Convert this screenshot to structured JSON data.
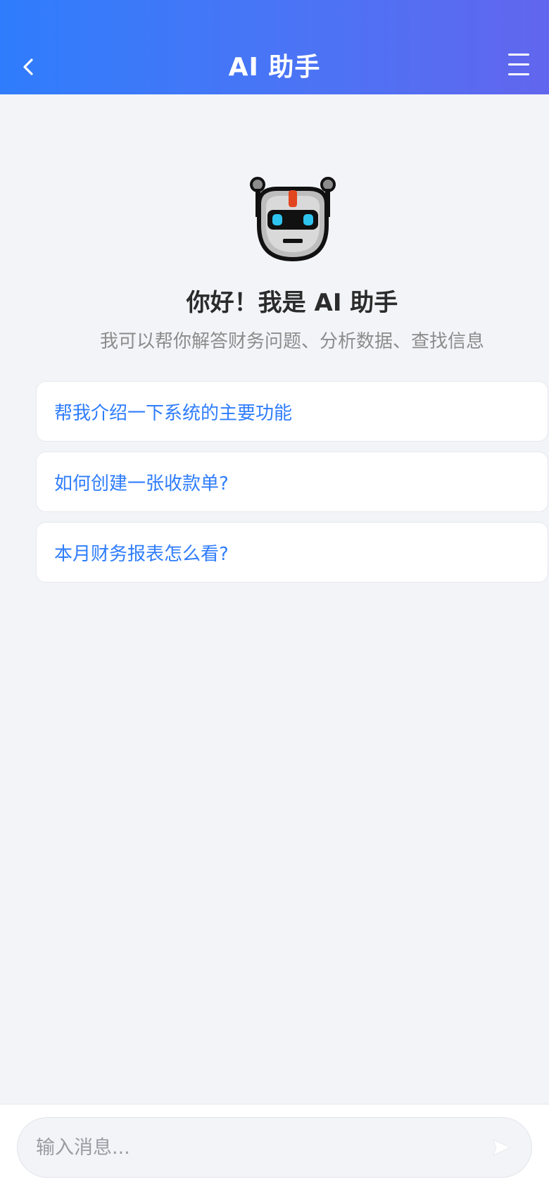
{
  "header": {
    "title": "AI 助手"
  },
  "welcome": {
    "greeting": "你好！我是 AI 助手",
    "subtitle": "我可以帮你解答财务问题、分析数据、查找信息"
  },
  "suggestions": [
    "帮我介绍一下系统的主要功能",
    "如何创建一张收款单?",
    "本月财务报表怎么看?"
  ],
  "input": {
    "placeholder": "输入消息..."
  },
  "icons": {
    "back": "chevron-left-icon",
    "menu": "hamburger-menu-icon",
    "avatar": "robot-icon",
    "send": "send-icon"
  },
  "colors": {
    "header_gradient_start": "#2f7dfc",
    "header_gradient_end": "#6166ee",
    "accent": "#2f7dfc",
    "background": "#f3f4f8"
  }
}
